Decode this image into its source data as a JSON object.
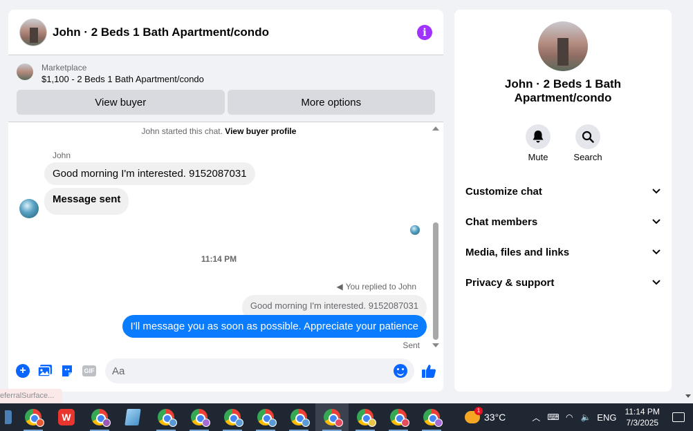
{
  "chat": {
    "title": "John · 2 Beds 1 Bath Apartment/condo",
    "marketplace_label": "Marketplace",
    "listing": "$1,100 - 2 Beds 1 Bath Apartment/condo",
    "view_buyer": "View buyer",
    "more_options": "More options",
    "sys_note_prefix": "John started this chat.",
    "sys_note_link": "View buyer profile",
    "sender_name": "John",
    "msg1": "Good morning I'm interested. 9152087031",
    "msg2": "Message sent",
    "timestamp": "11:14 PM",
    "replied_label": "You replied to John",
    "quoted": "Good morning I'm interested. 9152087031",
    "reply": "I'll message you as soon as possible. Appreciate your patience",
    "sent_label": "Sent",
    "input_placeholder": "Aa",
    "gif_label": "GIF"
  },
  "tooltip": "eferralSurface...",
  "info": {
    "name": "John · 2 Beds 1 Bath Apartment/condo",
    "mute": "Mute",
    "search": "Search",
    "sections": [
      "Customize chat",
      "Chat members",
      "Media, files and links",
      "Privacy & support"
    ]
  },
  "taskbar": {
    "temperature": "33°C",
    "language": "ENG",
    "time": "11:14 PM",
    "date": "7/3/2025",
    "weather_badge": "1"
  },
  "colors": {
    "accent": "#0866ff",
    "outgoing_bubble": "#0a7cff",
    "info_icon": "#a033ff"
  }
}
